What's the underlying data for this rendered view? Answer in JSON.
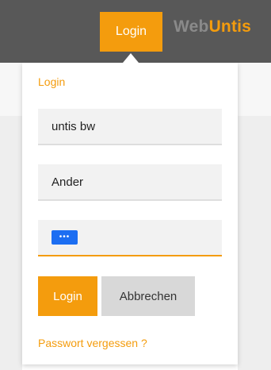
{
  "header": {
    "login_label": "Login",
    "logo_part1": "Web",
    "logo_part2": "Untis"
  },
  "popup": {
    "title": "Login",
    "school_value": "untis bw",
    "username_value": "Ander",
    "password_value": "•••",
    "login_button": "Login",
    "cancel_button": "Abbrechen",
    "forgot_link": "Passwort vergessen ?"
  },
  "colors": {
    "accent": "#f49c0d",
    "header_bg": "#585858",
    "field_bg": "#f2f2f2",
    "cancel_bg": "#d8d8d8"
  }
}
